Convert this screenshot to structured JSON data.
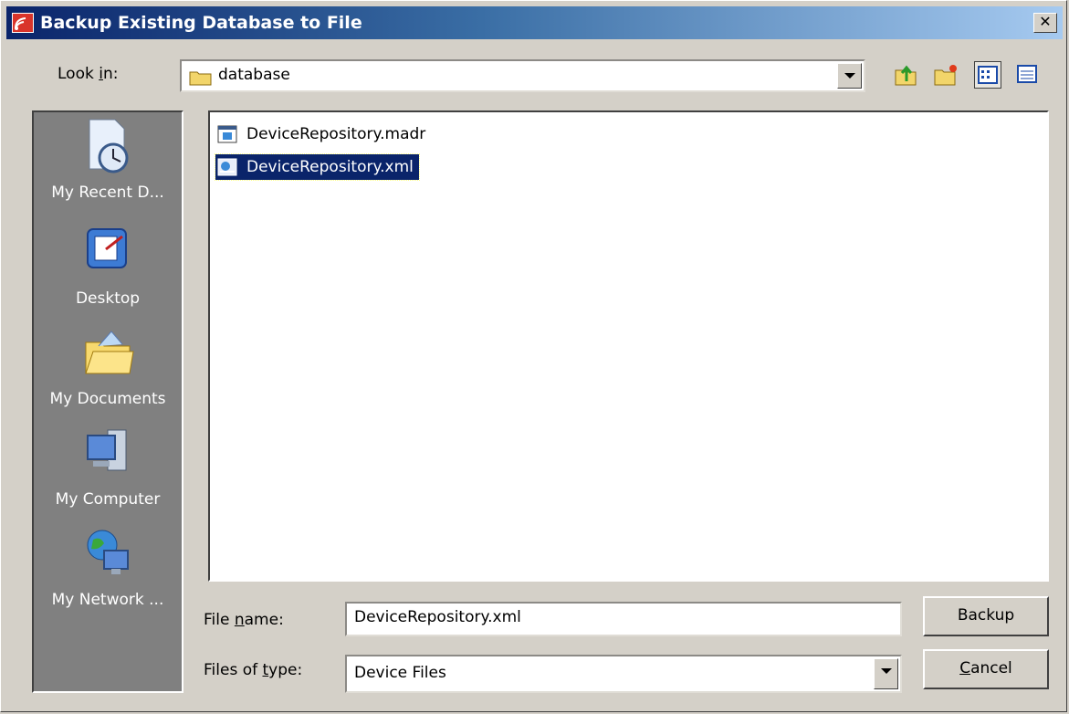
{
  "window": {
    "title": "Backup Existing Database to File",
    "close_glyph": "✕"
  },
  "lookin": {
    "label_pre": "Look ",
    "label_ul": "i",
    "label_post": "n:",
    "value": "database"
  },
  "toolbar": {
    "icons": [
      "up-folder-icon",
      "new-folder-icon",
      "list-view-icon",
      "details-view-icon"
    ]
  },
  "places": [
    {
      "label": "My Recent D...",
      "icon": "recent-documents-icon"
    },
    {
      "label": "Desktop",
      "icon": "desktop-icon"
    },
    {
      "label": "My Documents",
      "icon": "my-documents-icon"
    },
    {
      "label": "My Computer",
      "icon": "my-computer-icon"
    },
    {
      "label": "My Network ...",
      "icon": "network-icon"
    }
  ],
  "files": [
    {
      "name": "DeviceRepository.madr",
      "selected": false,
      "icon": "madr-file-icon"
    },
    {
      "name": "DeviceRepository.xml",
      "selected": true,
      "icon": "xml-file-icon"
    }
  ],
  "filename": {
    "label_pre": "File ",
    "label_ul": "n",
    "label_post": "ame:",
    "value": "DeviceRepository.xml"
  },
  "filetype": {
    "label_pre": "Files of ",
    "label_ul": "t",
    "label_post": "ype:",
    "value": "Device Files"
  },
  "buttons": {
    "backup": "Backup",
    "cancel_ul": "C",
    "cancel_rest": "ancel"
  },
  "colors": {
    "title_start": "#0a246a",
    "title_end": "#a6caf0",
    "selection": "#0a246a",
    "panel": "#808080"
  }
}
